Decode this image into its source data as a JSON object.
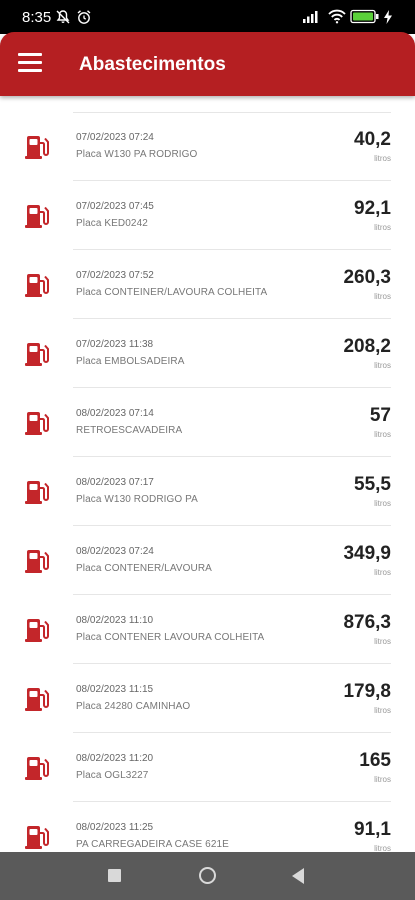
{
  "status_bar": {
    "time": "8:35"
  },
  "app_bar": {
    "title": "Abastecimentos"
  },
  "colors": {
    "brand": "#b51f22"
  },
  "list": {
    "items": [
      {
        "date": "07/02/2023 07:24",
        "placa": "Placa W130 PA RODRIGO",
        "value": "40,2",
        "unit": "litros",
        "icon": "fuel-pump-icon"
      },
      {
        "date": "07/02/2023 07:45",
        "placa": "Placa KED0242",
        "value": "92,1",
        "unit": "litros",
        "icon": "fuel-pump-icon"
      },
      {
        "date": "07/02/2023 07:52",
        "placa": "Placa CONTEINER/LAVOURA COLHEITA",
        "value": "260,3",
        "unit": "litros",
        "icon": "fuel-pump-icon"
      },
      {
        "date": "07/02/2023 11:38",
        "placa": "Placa EMBOLSADEIRA",
        "value": "208,2",
        "unit": "litros",
        "icon": "fuel-pump-icon"
      },
      {
        "date": "08/02/2023 07:14",
        "placa": "RETROESCAVADEIRA",
        "value": "57",
        "unit": "litros",
        "icon": "fuel-pump-icon"
      },
      {
        "date": "08/02/2023 07:17",
        "placa": "Placa W130 RODRIGO PA",
        "value": "55,5",
        "unit": "litros",
        "icon": "fuel-pump-icon"
      },
      {
        "date": "08/02/2023 07:24",
        "placa": "Placa CONTENER/LAVOURA",
        "value": "349,9",
        "unit": "litros",
        "icon": "fuel-pump-icon"
      },
      {
        "date": "08/02/2023 11:10",
        "placa": "Placa CONTENER LAVOURA COLHEITA",
        "value": "876,3",
        "unit": "litros",
        "icon": "fuel-pump-icon"
      },
      {
        "date": "08/02/2023 11:15",
        "placa": "Placa 24280 CAMINHAO",
        "value": "179,8",
        "unit": "litros",
        "icon": "fuel-pump-icon"
      },
      {
        "date": "08/02/2023 11:20",
        "placa": "Placa OGL3227",
        "value": "165",
        "unit": "litros",
        "icon": "fuel-pump-icon"
      },
      {
        "date": "08/02/2023 11:25",
        "placa": "PA CARREGADEIRA CASE 621E",
        "value": "91,1",
        "unit": "litros",
        "icon": "fuel-pump-icon"
      }
    ]
  }
}
